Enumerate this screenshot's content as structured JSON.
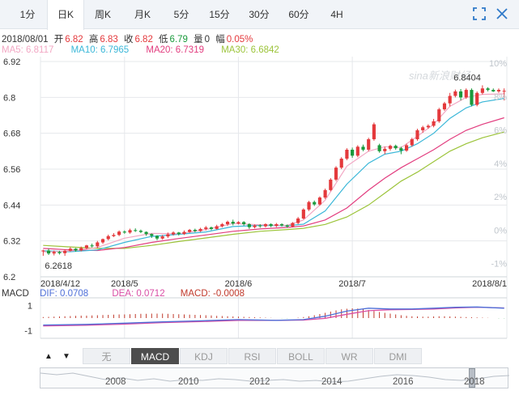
{
  "tabs": [
    {
      "label": "1分",
      "active": false
    },
    {
      "label": "日K",
      "active": true
    },
    {
      "label": "周K",
      "active": false
    },
    {
      "label": "月K",
      "active": false
    },
    {
      "label": "5分",
      "active": false
    },
    {
      "label": "15分",
      "active": false
    },
    {
      "label": "30分",
      "active": false
    },
    {
      "label": "60分",
      "active": false
    },
    {
      "label": "4H",
      "active": false
    }
  ],
  "icons": {
    "fullscreen": "fullscreen-icon",
    "close": "close-icon"
  },
  "quote": {
    "date": "2018/08/01",
    "open_label": "开",
    "open": "6.82",
    "high_label": "高",
    "high": "6.83",
    "close_label": "收",
    "close": "6.82",
    "low_label": "低",
    "low": "6.79",
    "volume_label": "量",
    "volume": "0",
    "change_label": "幅",
    "change": "0.05%"
  },
  "ma_legend": {
    "ma5": "MA5: 6.8117",
    "ma10": "MA10: 6.7965",
    "ma20": "MA20: 6.7319",
    "ma30": "MA30: 6.6842"
  },
  "colors": {
    "up": "#e4393c",
    "down": "#1a9a3c",
    "ma5": "#f2a7c3",
    "ma10": "#3ab7d8",
    "ma20": "#e23d7f",
    "ma30": "#9cc43a",
    "dif": "#4e6fd8",
    "dea": "#d94ea5",
    "grid": "#e6e8eb"
  },
  "watermark": "sina新浪财经",
  "chart_data": {
    "type": "candlestick",
    "y_axis": {
      "ticks": [
        6.2,
        6.32,
        6.44,
        6.56,
        6.68,
        6.8,
        6.92
      ],
      "ylim": [
        6.2,
        6.92
      ]
    },
    "pct_axis": {
      "ticks": [
        "10%",
        "8%",
        "6%",
        "4%",
        "2%",
        "0%",
        "-1%"
      ]
    },
    "x_labels": [
      "2018/4/12",
      "2018/5",
      "2018/6",
      "2018/7",
      "2018/8/1"
    ],
    "x_label_index": [
      0,
      15,
      36,
      57,
      78
    ],
    "max_label": "6.8404",
    "min_label": "6.2618",
    "candles": [
      [
        6.285,
        6.288,
        6.27,
        6.2905
      ],
      [
        6.288,
        6.278,
        6.273,
        6.294
      ],
      [
        6.278,
        6.283,
        6.2715,
        6.288
      ],
      [
        6.283,
        6.279,
        6.2745,
        6.287
      ],
      [
        6.279,
        6.287,
        6.27,
        6.292
      ],
      [
        6.287,
        6.294,
        6.2845,
        6.299
      ],
      [
        6.294,
        6.288,
        6.284,
        6.296
      ],
      [
        6.288,
        6.296,
        6.285,
        6.301
      ],
      [
        6.296,
        6.305,
        6.292,
        6.307
      ],
      [
        6.305,
        6.302,
        6.298,
        6.311
      ],
      [
        6.302,
        6.315,
        6.296,
        6.32
      ],
      [
        6.315,
        6.326,
        6.31,
        6.328
      ],
      [
        6.326,
        6.336,
        6.322,
        6.341
      ],
      [
        6.336,
        6.34,
        6.333,
        6.346
      ],
      [
        6.34,
        6.351,
        6.336,
        6.355
      ],
      [
        6.351,
        6.348,
        6.344,
        6.355
      ],
      [
        6.348,
        6.356,
        6.344,
        6.361
      ],
      [
        6.356,
        6.354,
        6.35,
        6.362
      ],
      [
        6.354,
        6.35,
        6.346,
        6.358
      ],
      [
        6.35,
        6.343,
        6.337,
        6.352
      ],
      [
        6.343,
        6.337,
        6.33,
        6.345
      ],
      [
        6.337,
        6.328,
        6.322,
        6.339
      ],
      [
        6.328,
        6.335,
        6.324,
        6.34
      ],
      [
        6.335,
        6.342,
        6.33,
        6.348
      ],
      [
        6.342,
        6.348,
        6.338,
        6.352
      ],
      [
        6.348,
        6.343,
        6.338,
        6.35
      ],
      [
        6.343,
        6.35,
        6.34,
        6.355
      ],
      [
        6.35,
        6.357,
        6.347,
        6.36
      ],
      [
        6.357,
        6.353,
        6.349,
        6.361
      ],
      [
        6.353,
        6.36,
        6.35,
        6.364
      ],
      [
        6.36,
        6.365,
        6.355,
        6.37
      ],
      [
        6.365,
        6.36,
        6.356,
        6.368
      ],
      [
        6.36,
        6.369,
        6.358,
        6.374
      ],
      [
        6.369,
        6.376,
        6.365,
        6.38
      ],
      [
        6.376,
        6.384,
        6.37,
        6.388
      ],
      [
        6.384,
        6.378,
        6.372,
        6.391
      ],
      [
        6.378,
        6.383,
        6.375,
        6.386
      ],
      [
        6.383,
        6.376,
        6.371,
        6.386
      ],
      [
        6.376,
        6.366,
        6.36,
        6.379
      ],
      [
        6.366,
        6.372,
        6.362,
        6.375
      ],
      [
        6.372,
        6.369,
        6.364,
        6.376
      ],
      [
        6.369,
        6.376,
        6.365,
        6.379
      ],
      [
        6.376,
        6.37,
        6.366,
        6.379
      ],
      [
        6.37,
        6.376,
        6.366,
        6.38
      ],
      [
        6.376,
        6.372,
        6.368,
        6.379
      ],
      [
        6.372,
        6.368,
        6.364,
        6.375
      ],
      [
        6.368,
        6.38,
        6.365,
        6.383
      ],
      [
        6.38,
        6.395,
        6.376,
        6.4
      ],
      [
        6.395,
        6.425,
        6.392,
        6.429
      ],
      [
        6.425,
        6.45,
        6.42,
        6.454
      ],
      [
        6.45,
        6.442,
        6.437,
        6.455
      ],
      [
        6.442,
        6.465,
        6.438,
        6.469
      ],
      [
        6.465,
        6.49,
        6.46,
        6.495
      ],
      [
        6.49,
        6.525,
        6.486,
        6.53
      ],
      [
        6.525,
        6.565,
        6.52,
        6.57
      ],
      [
        6.565,
        6.595,
        6.56,
        6.6
      ],
      [
        6.595,
        6.625,
        6.59,
        6.63
      ],
      [
        6.625,
        6.605,
        6.598,
        6.632
      ],
      [
        6.605,
        6.635,
        6.6,
        6.64
      ],
      [
        6.635,
        6.625,
        6.62,
        6.642
      ],
      [
        6.625,
        6.66,
        6.62,
        6.665
      ],
      [
        6.66,
        6.71,
        6.655,
        6.716
      ],
      [
        6.64,
        6.62,
        6.615,
        6.645
      ],
      [
        6.62,
        6.628,
        6.61,
        6.635
      ],
      [
        6.628,
        6.638,
        6.622,
        6.642
      ],
      [
        6.638,
        6.63,
        6.625,
        6.642
      ],
      [
        6.63,
        6.622,
        6.61,
        6.635
      ],
      [
        6.622,
        6.64,
        6.618,
        6.645
      ],
      [
        6.64,
        6.66,
        6.635,
        6.665
      ],
      [
        6.66,
        6.69,
        6.655,
        6.695
      ],
      [
        6.69,
        6.7,
        6.682,
        6.705
      ],
      [
        6.7,
        6.705,
        6.695,
        6.71
      ],
      [
        6.705,
        6.72,
        6.7,
        6.728
      ],
      [
        6.72,
        6.76,
        6.715,
        6.765
      ],
      [
        6.76,
        6.78,
        6.755,
        6.785
      ],
      [
        6.78,
        6.805,
        6.77,
        6.815
      ],
      [
        6.805,
        6.82,
        6.8,
        6.826
      ],
      [
        6.82,
        6.8,
        6.79,
        6.828
      ],
      [
        6.8,
        6.825,
        6.795,
        6.83
      ],
      [
        6.825,
        6.775,
        6.77,
        6.83
      ],
      [
        6.775,
        6.815,
        6.77,
        6.82
      ],
      [
        6.815,
        6.83,
        6.81,
        6.8404
      ],
      [
        6.83,
        6.825,
        6.82,
        6.834
      ],
      [
        6.825,
        6.82,
        6.818,
        6.83
      ],
      [
        6.82,
        6.825,
        6.815,
        6.83
      ],
      [
        6.82,
        6.822,
        6.79,
        6.83
      ]
    ],
    "ma5": [
      [
        0,
        6.283
      ],
      [
        5,
        6.286
      ],
      [
        10,
        6.298
      ],
      [
        15,
        6.329
      ],
      [
        20,
        6.345
      ],
      [
        25,
        6.344
      ],
      [
        30,
        6.358
      ],
      [
        35,
        6.378
      ],
      [
        40,
        6.374
      ],
      [
        45,
        6.372
      ],
      [
        48,
        6.39
      ],
      [
        52,
        6.456
      ],
      [
        56,
        6.57
      ],
      [
        60,
        6.62
      ],
      [
        63,
        6.635
      ],
      [
        66,
        6.632
      ],
      [
        69,
        6.67
      ],
      [
        72,
        6.71
      ],
      [
        75,
        6.77
      ],
      [
        78,
        6.8
      ],
      [
        81,
        6.81
      ],
      [
        85,
        6.8117
      ]
    ],
    "ma10": [
      [
        0,
        6.287
      ],
      [
        5,
        6.284
      ],
      [
        10,
        6.29
      ],
      [
        15,
        6.315
      ],
      [
        20,
        6.335
      ],
      [
        25,
        6.342
      ],
      [
        30,
        6.35
      ],
      [
        35,
        6.368
      ],
      [
        40,
        6.372
      ],
      [
        45,
        6.371
      ],
      [
        48,
        6.376
      ],
      [
        52,
        6.42
      ],
      [
        56,
        6.51
      ],
      [
        60,
        6.58
      ],
      [
        63,
        6.61
      ],
      [
        66,
        6.62
      ],
      [
        69,
        6.645
      ],
      [
        72,
        6.68
      ],
      [
        75,
        6.73
      ],
      [
        78,
        6.765
      ],
      [
        81,
        6.785
      ],
      [
        85,
        6.7965
      ]
    ],
    "ma20": [
      [
        0,
        6.295
      ],
      [
        5,
        6.29
      ],
      [
        10,
        6.288
      ],
      [
        15,
        6.298
      ],
      [
        20,
        6.315
      ],
      [
        25,
        6.328
      ],
      [
        30,
        6.34
      ],
      [
        35,
        6.352
      ],
      [
        40,
        6.36
      ],
      [
        45,
        6.365
      ],
      [
        48,
        6.37
      ],
      [
        52,
        6.39
      ],
      [
        56,
        6.43
      ],
      [
        60,
        6.49
      ],
      [
        63,
        6.53
      ],
      [
        66,
        6.565
      ],
      [
        69,
        6.595
      ],
      [
        72,
        6.625
      ],
      [
        75,
        6.66
      ],
      [
        78,
        6.69
      ],
      [
        81,
        6.71
      ],
      [
        85,
        6.7319
      ]
    ],
    "ma30": [
      [
        0,
        6.305
      ],
      [
        5,
        6.3
      ],
      [
        10,
        6.295
      ],
      [
        15,
        6.295
      ],
      [
        20,
        6.305
      ],
      [
        25,
        6.318
      ],
      [
        30,
        6.33
      ],
      [
        35,
        6.342
      ],
      [
        40,
        6.352
      ],
      [
        45,
        6.358
      ],
      [
        48,
        6.362
      ],
      [
        52,
        6.375
      ],
      [
        56,
        6.4
      ],
      [
        60,
        6.44
      ],
      [
        63,
        6.48
      ],
      [
        66,
        6.52
      ],
      [
        69,
        6.55
      ],
      [
        72,
        6.585
      ],
      [
        75,
        6.62
      ],
      [
        78,
        6.645
      ],
      [
        81,
        6.665
      ],
      [
        85,
        6.6842
      ]
    ],
    "macd_panel": {
      "legend": {
        "title": "MACD",
        "dif": "DIF: 0.0708",
        "dea": "DEA: 0.0712",
        "macd": "MACD: -0.0008"
      },
      "y_ticks": [
        "1",
        "-1"
      ],
      "ylim": [
        -1.6,
        1.6
      ],
      "dif": [
        [
          0,
          -0.55
        ],
        [
          8,
          -0.5
        ],
        [
          15,
          -0.4
        ],
        [
          22,
          -0.3
        ],
        [
          29,
          -0.22
        ],
        [
          36,
          -0.12
        ],
        [
          43,
          -0.18
        ],
        [
          48,
          -0.12
        ],
        [
          52,
          0.15
        ],
        [
          56,
          0.55
        ],
        [
          60,
          0.78
        ],
        [
          64,
          0.72
        ],
        [
          68,
          0.72
        ],
        [
          72,
          0.78
        ],
        [
          76,
          0.85
        ],
        [
          80,
          0.88
        ],
        [
          85,
          0.78
        ]
      ],
      "dea": [
        [
          0,
          -0.62
        ],
        [
          8,
          -0.56
        ],
        [
          15,
          -0.48
        ],
        [
          22,
          -0.36
        ],
        [
          29,
          -0.28
        ],
        [
          36,
          -0.18
        ],
        [
          43,
          -0.18
        ],
        [
          48,
          -0.16
        ],
        [
          52,
          -0.02
        ],
        [
          56,
          0.3
        ],
        [
          60,
          0.58
        ],
        [
          64,
          0.66
        ],
        [
          68,
          0.68
        ],
        [
          72,
          0.72
        ],
        [
          76,
          0.8
        ],
        [
          80,
          0.86
        ],
        [
          85,
          0.8
        ]
      ],
      "histogram": [
        0.05,
        0.06,
        0.07,
        0.08,
        0.09,
        0.1,
        0.11,
        0.12,
        0.12,
        0.13,
        0.14,
        0.15,
        0.16,
        0.17,
        0.18,
        0.18,
        0.19,
        0.2,
        0.21,
        0.21,
        0.22,
        0.22,
        0.22,
        0.21,
        0.2,
        0.19,
        0.18,
        0.17,
        0.16,
        0.15,
        0.14,
        0.13,
        0.11,
        0.1,
        0.09,
        0.08,
        0.07,
        0.06,
        0.05,
        0.04,
        0.03,
        0.02,
        0.01,
        0.0,
        -0.01,
        -0.01,
        0.0,
        0.02,
        0.05,
        0.09,
        0.14,
        0.2,
        0.26,
        0.32,
        0.38,
        0.43,
        0.46,
        0.48,
        0.47,
        0.44,
        0.4,
        0.35,
        0.3,
        0.26,
        0.22,
        0.18,
        0.14,
        0.11,
        0.09,
        0.08,
        0.07,
        0.07,
        0.08,
        0.09,
        0.09,
        0.08,
        0.07,
        0.06,
        0.05,
        0.04,
        0.03,
        0.02,
        0.01,
        0.0,
        -0.01,
        -0.01
      ]
    },
    "navigator": {
      "years": [
        "2008",
        "2010",
        "2012",
        "2014",
        "2016",
        "2018"
      ]
    }
  },
  "indicator_bar": {
    "up_arrow": "▲",
    "down_arrow": "▼",
    "items": [
      {
        "label": "无",
        "active": false
      },
      {
        "label": "MACD",
        "active": true
      },
      {
        "label": "KDJ",
        "active": false
      },
      {
        "label": "RSI",
        "active": false
      },
      {
        "label": "BOLL",
        "active": false
      },
      {
        "label": "WR",
        "active": false
      },
      {
        "label": "DMI",
        "active": false
      }
    ]
  }
}
